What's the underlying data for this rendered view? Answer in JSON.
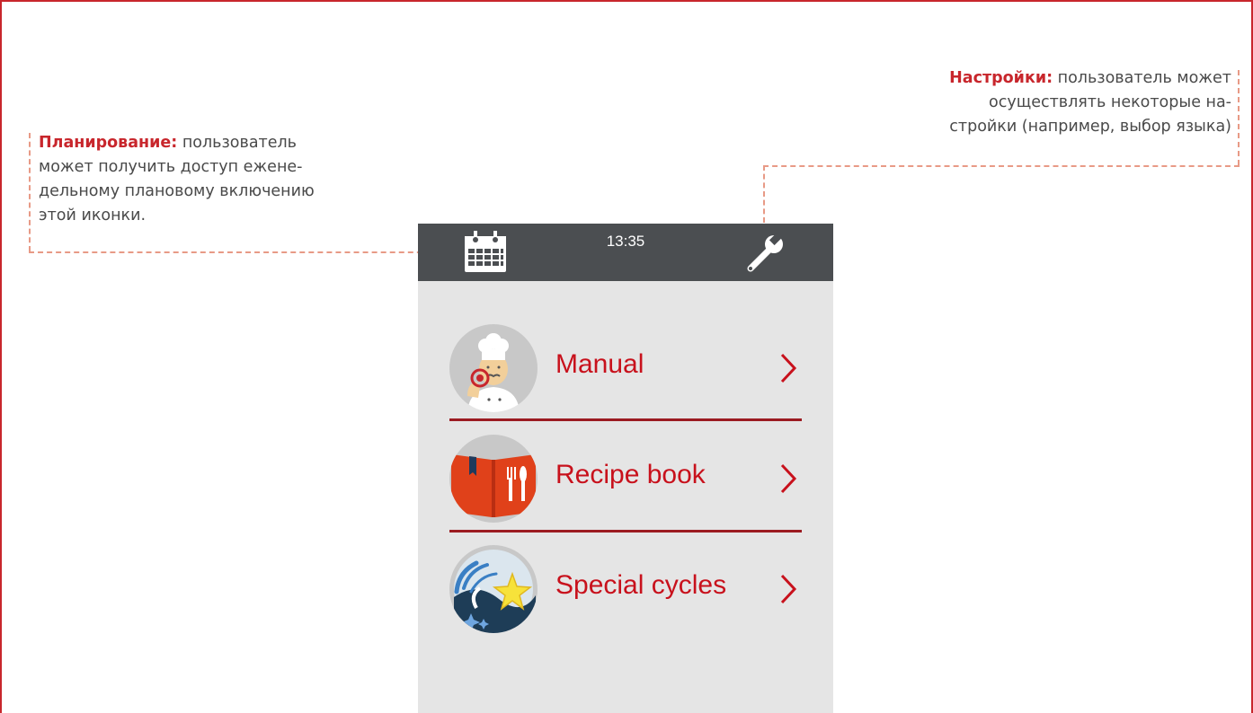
{
  "callouts": {
    "planning": {
      "title": "Планирование:",
      "line1": " пользователь",
      "line2": "может получить доступ ежене-",
      "line3": "дельному плановому включению",
      "line4": "этой иконки."
    },
    "settings": {
      "title": "Настройки:",
      "line1": " пользователь может",
      "line2": "осуществлять некоторые на-",
      "line3": "стройки (например, выбор языка)"
    }
  },
  "device": {
    "clock": "13:35",
    "icons": {
      "schedule": "calendar-icon",
      "settings": "wrench-icon"
    },
    "menu": [
      {
        "label": "Manual",
        "icon": "chef-icon"
      },
      {
        "label": "Recipe book",
        "icon": "recipe-book-icon"
      },
      {
        "label": "Special cycles",
        "icon": "special-cycles-icon"
      }
    ]
  },
  "colors": {
    "accent": "#c8262c",
    "menu_text": "#c8111c",
    "separator": "#9b1b21",
    "topbar": "#4b4e51",
    "screen_bg": "#e5e5e5",
    "callout_line": "#e89a86"
  }
}
